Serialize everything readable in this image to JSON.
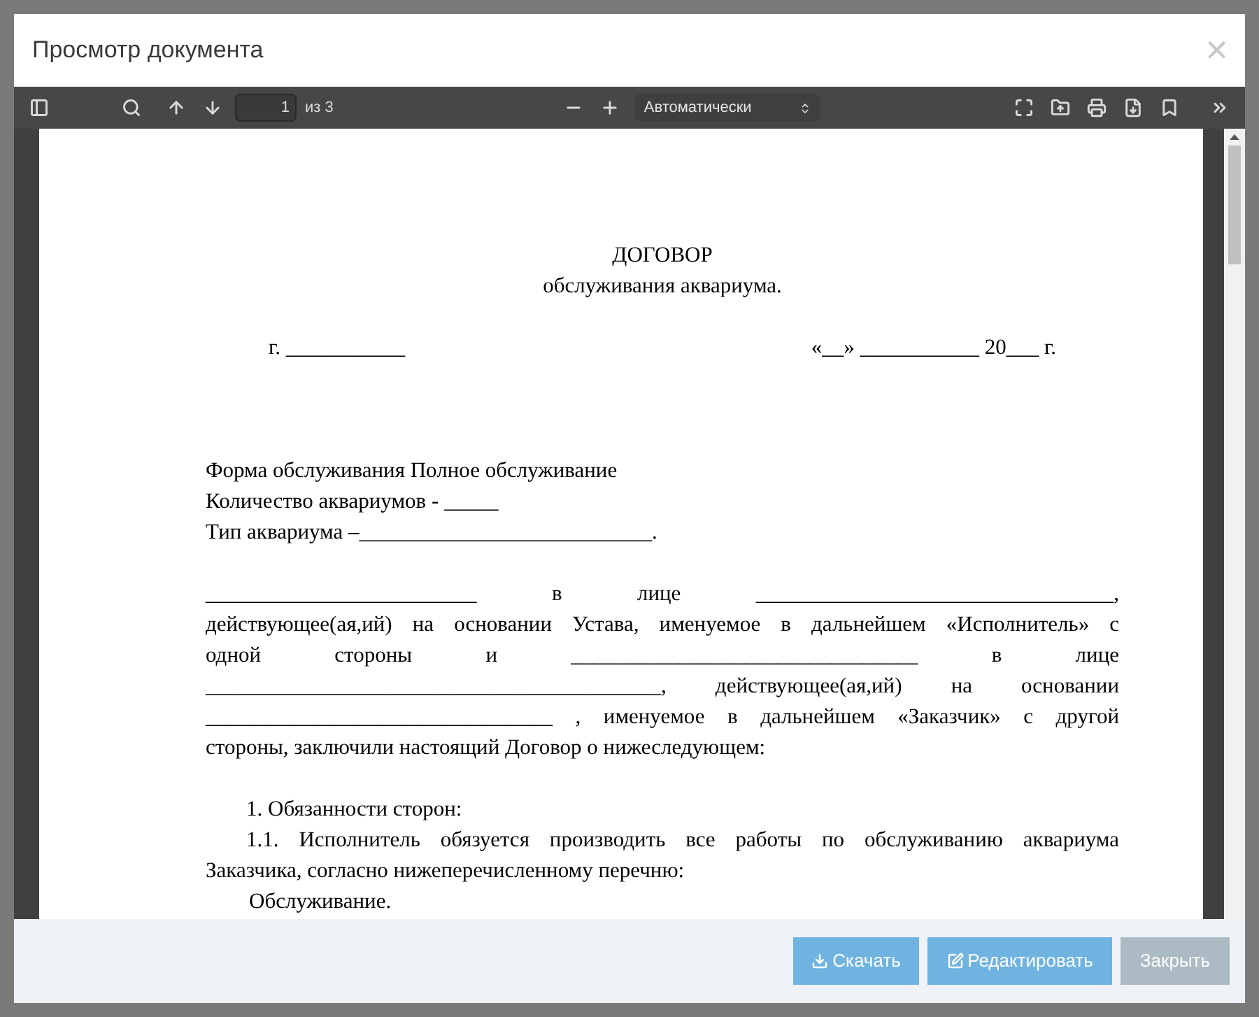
{
  "dialog": {
    "title": "Просмотр документа",
    "close": "×"
  },
  "toolbar": {
    "page_value": "1",
    "page_count": "из 3",
    "zoom": "Автоматически"
  },
  "document": {
    "lines": [
      {
        "kind": "center",
        "text": "ДОГОВОР"
      },
      {
        "kind": "center",
        "text": "обслуживания аквариума."
      },
      {
        "kind": "gap"
      },
      {
        "kind": "split",
        "left": "г. ___________",
        "right": "«__» ___________ 20___ г."
      },
      {
        "kind": "gap"
      },
      {
        "kind": "gap"
      },
      {
        "kind": "gap"
      },
      {
        "kind": "plain",
        "text": "Форма обслуживания Полное обслуживание"
      },
      {
        "kind": "plain",
        "text": "Количество аквариумов - _____"
      },
      {
        "kind": "plain",
        "text": "Тип аквариума –___________________________."
      },
      {
        "kind": "gap"
      },
      {
        "kind": "justify",
        "text": "_________________________ в лице _________________________________,"
      },
      {
        "kind": "justify",
        "text": "действующее(ая,ий) на основании Устава, именуемое в дальнейшем «Исполнитель» с"
      },
      {
        "kind": "justify",
        "text": "одной стороны и ________________________________ в лице"
      },
      {
        "kind": "justify",
        "text": "__________________________________________, действующее(ая,ий) на основании"
      },
      {
        "kind": "justify",
        "text": "________________________________ , именуемое в дальнейшем «Заказчик» с другой"
      },
      {
        "kind": "plain",
        "text": "стороны, заключили настоящий Договор о нижеследующем:"
      },
      {
        "kind": "gap"
      },
      {
        "kind": "indent",
        "text": "1. Обязанности сторон:"
      },
      {
        "kind": "indent-justify",
        "text": "1.1. Исполнитель обязуется производить все работы по обслуживанию аквариума"
      },
      {
        "kind": "plain",
        "text": "Заказчика, согласно нижеперечисленному перечню:"
      },
      {
        "kind": "indent-small",
        "text": "Обслуживание."
      }
    ]
  },
  "footer": {
    "buttons": [
      {
        "kind": "download",
        "label": "Скачать"
      },
      {
        "kind": "edit",
        "label": "Редактировать"
      },
      {
        "kind": "close",
        "label": "Закрыть"
      }
    ]
  }
}
